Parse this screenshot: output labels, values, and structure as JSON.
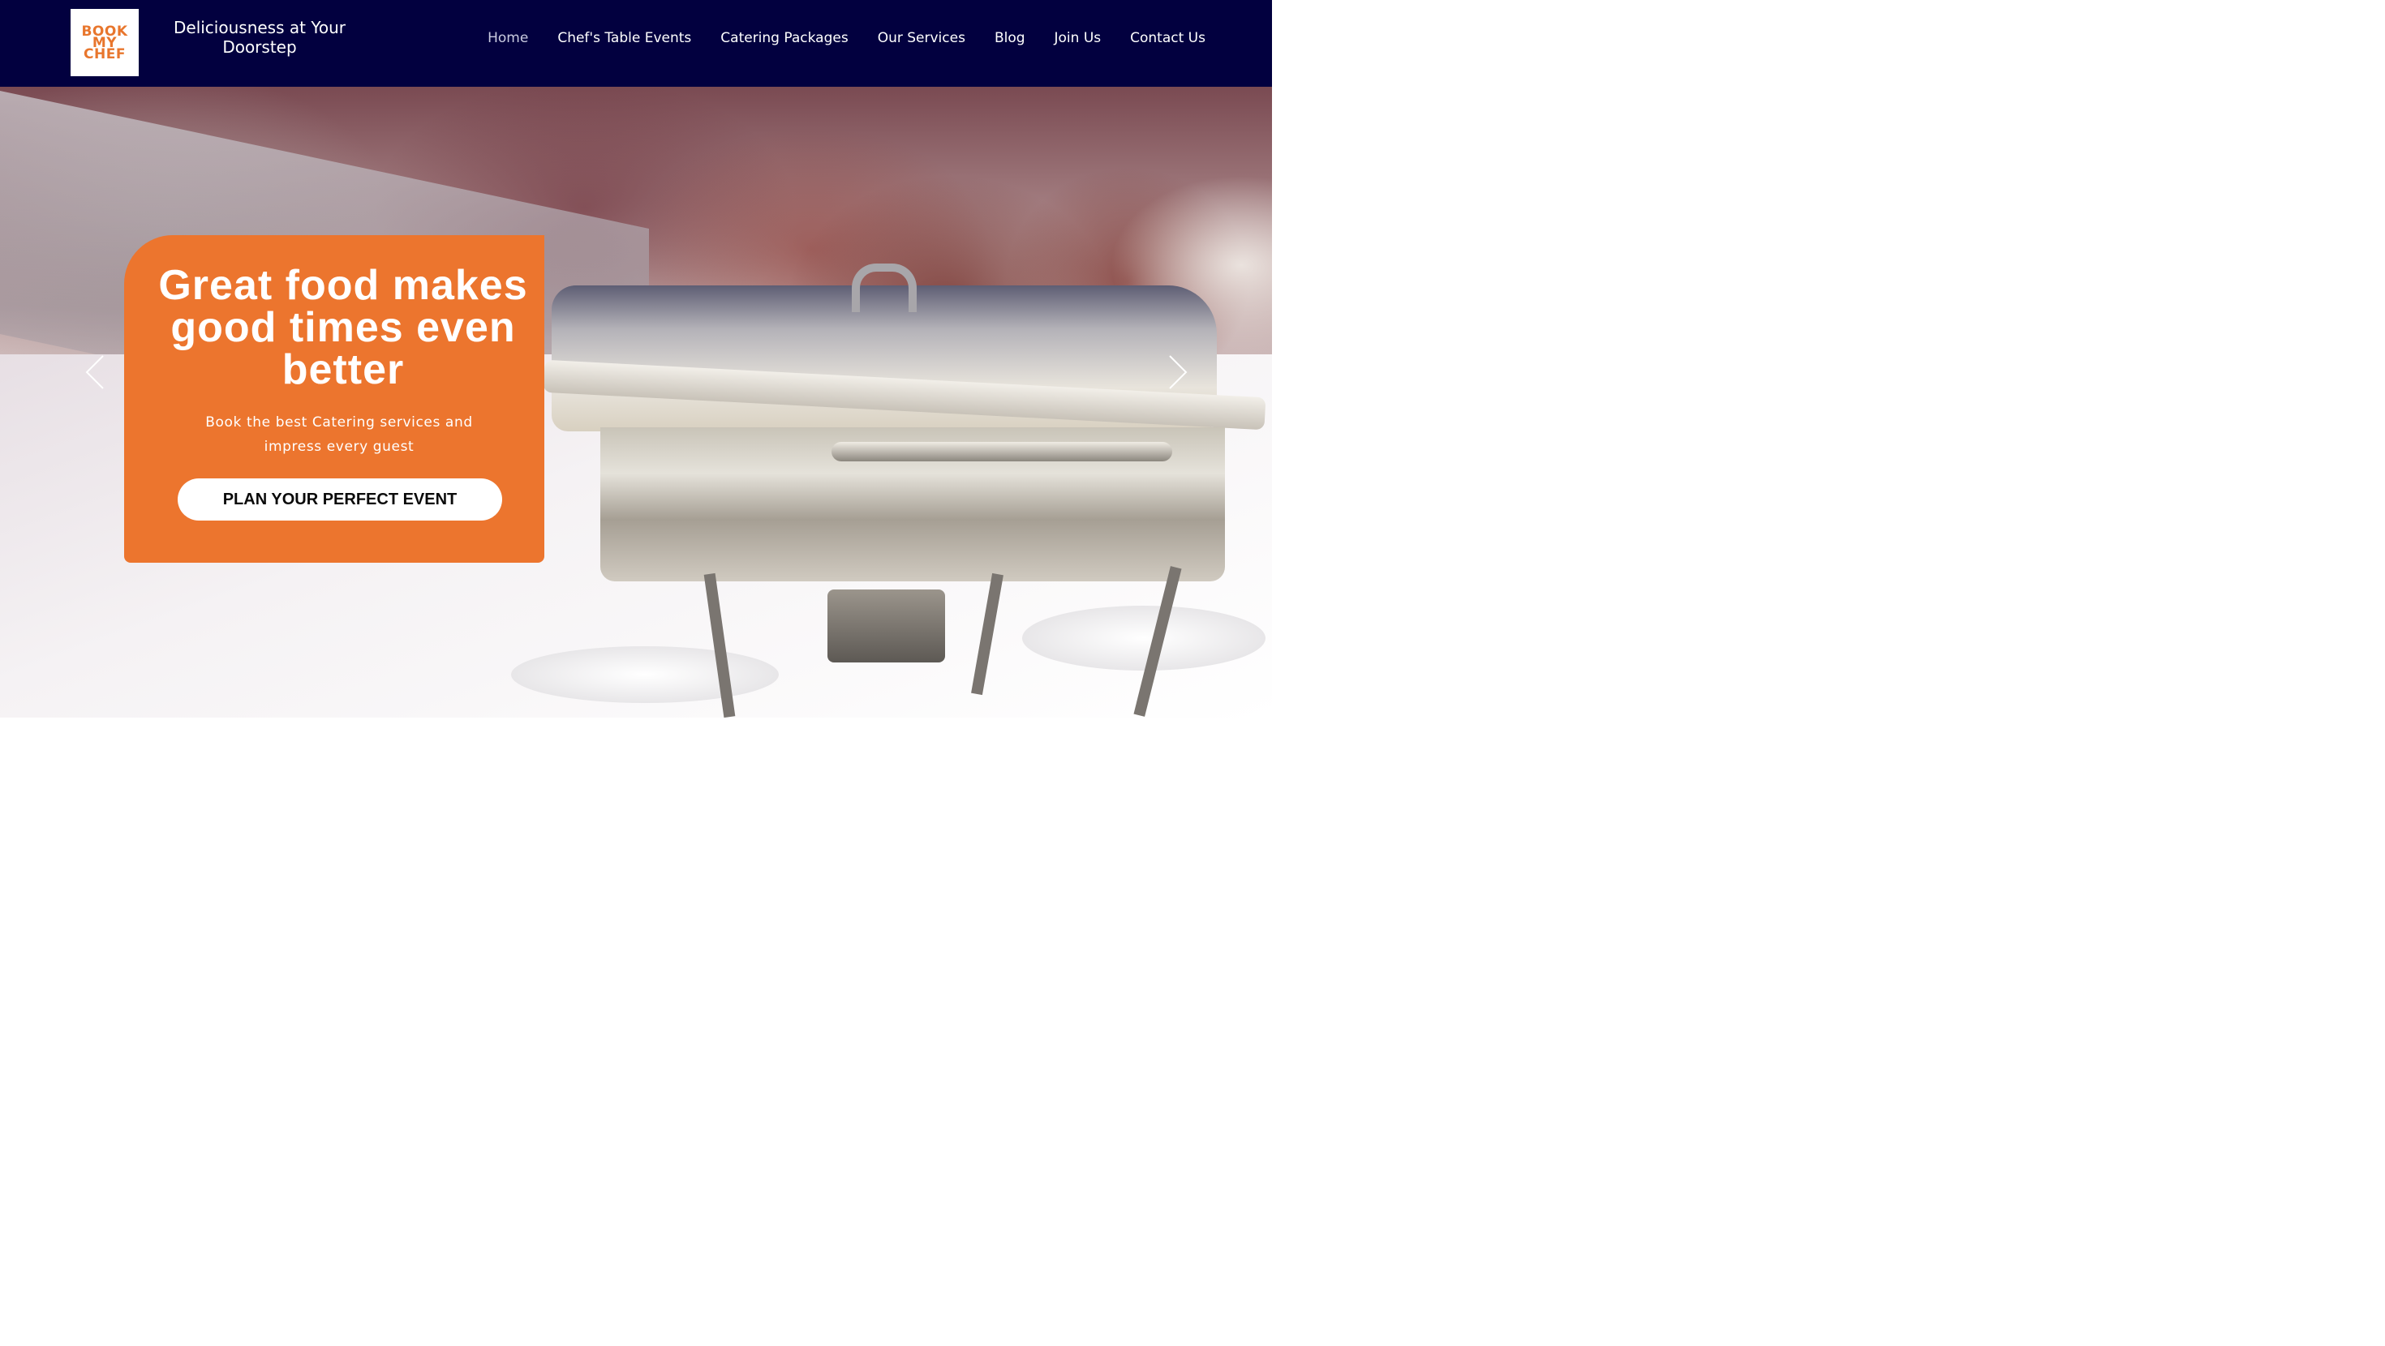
{
  "brand": {
    "logo_lines": [
      "BOOK",
      "MY",
      "CHEF"
    ],
    "tagline": "Deliciousness at Your Doorstep",
    "logo_color": "#e8762d"
  },
  "nav": {
    "items": [
      {
        "label": "Home",
        "active": true
      },
      {
        "label": "Chef's Table Events",
        "active": false
      },
      {
        "label": "Catering Packages",
        "active": false
      },
      {
        "label": "Our Services",
        "active": false
      },
      {
        "label": "Blog",
        "active": false
      },
      {
        "label": "Join Us",
        "active": false
      },
      {
        "label": "Contact Us",
        "active": false
      }
    ]
  },
  "hero": {
    "title": "Great food makes good times even better",
    "subtitle": "Book the best Catering services and impress every guest",
    "cta_label": "PLAN YOUR PERFECT EVENT",
    "prev_icon": "chevron-left-icon",
    "next_icon": "chevron-right-icon"
  },
  "colors": {
    "header_bg": "#02003f",
    "accent": "#ec752e",
    "button_bg": "#ffffff"
  }
}
